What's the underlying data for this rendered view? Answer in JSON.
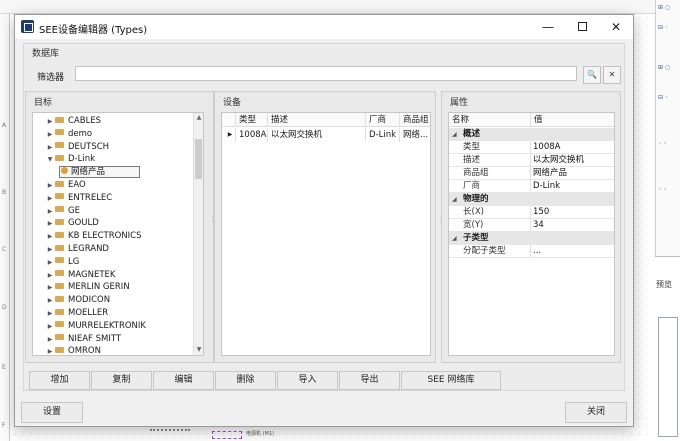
{
  "background": {
    "preview_tab": "预览",
    "ruler_letters": [
      "A",
      "B",
      "C",
      "D",
      "E",
      "F"
    ],
    "bottom_symbol_label": "电源机 (M1)"
  },
  "dialog": {
    "title": "SEE设备编辑器 (Types)",
    "window_buttons": {
      "minimize": "—",
      "close": "✕"
    },
    "database_label": "数据库",
    "filter": {
      "label": "筛选器",
      "value": "",
      "search_glyph": "🔍",
      "clear_glyph": "✕"
    },
    "target": {
      "title": "目标",
      "items": [
        {
          "label": "CABLES",
          "expanded": false
        },
        {
          "label": "demo",
          "expanded": false
        },
        {
          "label": "DEUTSCH",
          "expanded": false
        },
        {
          "label": "D-Link",
          "expanded": true
        },
        {
          "label": "网络产品",
          "child": true,
          "selected": true
        },
        {
          "label": "EAO",
          "expanded": false
        },
        {
          "label": "ENTRELEC",
          "expanded": false
        },
        {
          "label": "GE",
          "expanded": false
        },
        {
          "label": "GOULD",
          "expanded": false
        },
        {
          "label": "KB ELECTRONICS",
          "expanded": false
        },
        {
          "label": "LEGRAND",
          "expanded": false
        },
        {
          "label": "LG",
          "expanded": false
        },
        {
          "label": "MAGNETEK",
          "expanded": false
        },
        {
          "label": "MERLIN GERIN",
          "expanded": false
        },
        {
          "label": "MODICON",
          "expanded": false
        },
        {
          "label": "MOELLER",
          "expanded": false
        },
        {
          "label": "MURRELEKTRONIK",
          "expanded": false
        },
        {
          "label": "NIEAF SMITT",
          "expanded": false
        },
        {
          "label": "OMRON",
          "expanded": false
        }
      ]
    },
    "devices": {
      "title": "设备",
      "columns": [
        "类型",
        "描述",
        "厂商",
        "商品组"
      ],
      "rows": [
        {
          "type": "1008A",
          "description": "以太网交换机",
          "vendor": "D-Link",
          "group": "网络..."
        }
      ]
    },
    "properties": {
      "title": "属性",
      "columns": [
        "名称",
        "值"
      ],
      "categories": [
        {
          "name": "概述",
          "rows": [
            {
              "key": "类型",
              "value": "1008A"
            },
            {
              "key": "描述",
              "value": "以太网交换机"
            },
            {
              "key": "商品组",
              "value": "网络产品"
            },
            {
              "key": "厂商",
              "value": "D-Link"
            }
          ]
        },
        {
          "name": "物理的",
          "rows": [
            {
              "key": "长(X)",
              "value": "150"
            },
            {
              "key": "宽(Y)",
              "value": "34"
            }
          ]
        },
        {
          "name": "子类型",
          "rows": [
            {
              "key": "分配子类型",
              "value": "..."
            }
          ]
        }
      ]
    },
    "toolbar": [
      "增加",
      "复制",
      "编辑",
      "删除",
      "导入",
      "导出",
      "SEE 网络库"
    ],
    "footer": {
      "settings": "设置",
      "close": "关闭"
    }
  }
}
